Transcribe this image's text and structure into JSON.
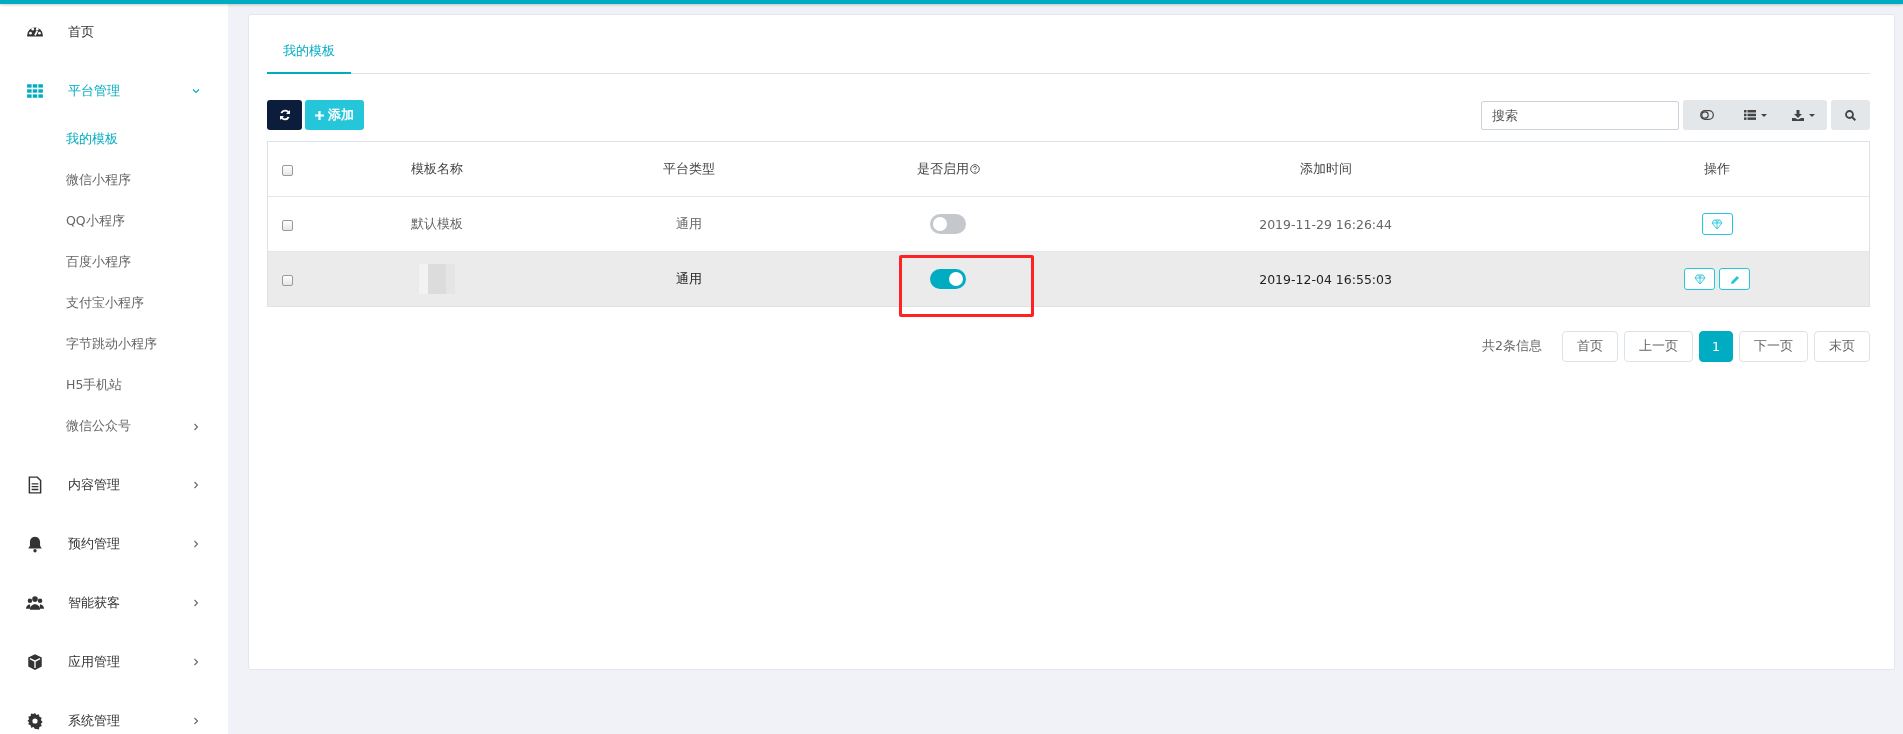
{
  "sidebar": {
    "items": [
      {
        "label": "首页",
        "selected": false,
        "has_arrow": false
      },
      {
        "label": "平台管理",
        "selected": true,
        "expanded": true,
        "has_arrow": true,
        "children": [
          {
            "label": "我的模板",
            "selected": true,
            "has_arrow": false
          },
          {
            "label": "微信小程序",
            "selected": false,
            "has_arrow": false
          },
          {
            "label": "QQ小程序",
            "selected": false,
            "has_arrow": false
          },
          {
            "label": "百度小程序",
            "selected": false,
            "has_arrow": false
          },
          {
            "label": "支付宝小程序",
            "selected": false,
            "has_arrow": false
          },
          {
            "label": "字节跳动小程序",
            "selected": false,
            "has_arrow": false
          },
          {
            "label": "H5手机站",
            "selected": false,
            "has_arrow": false
          },
          {
            "label": "微信公众号",
            "selected": false,
            "has_arrow": true
          }
        ]
      },
      {
        "label": "内容管理",
        "selected": false,
        "expanded": false,
        "has_arrow": true
      },
      {
        "label": "预约管理",
        "selected": false,
        "expanded": false,
        "has_arrow": true
      },
      {
        "label": "智能获客",
        "selected": false,
        "expanded": false,
        "has_arrow": true
      },
      {
        "label": "应用管理",
        "selected": false,
        "expanded": false,
        "has_arrow": true
      },
      {
        "label": "系统管理",
        "selected": false,
        "expanded": false,
        "has_arrow": true
      }
    ]
  },
  "tabs": [
    {
      "label": "我的模板",
      "selected": true
    }
  ],
  "toolbar": {
    "add_label": "添加",
    "search": {
      "placeholder": "搜索"
    }
  },
  "table": {
    "all_checked": false,
    "columns": [
      "模板名称",
      "平台类型",
      "是否启用",
      "添加时间",
      "操作"
    ],
    "rows": [
      {
        "checked": false,
        "selected": false,
        "highlighted": false,
        "name": {
          "kind": "text",
          "text": "默认模板"
        },
        "platform": "通用",
        "on": false,
        "time": "2019-11-29 16:26:44",
        "editable": false
      },
      {
        "checked": false,
        "selected": true,
        "highlighted": true,
        "name": {
          "kind": "redacted"
        },
        "platform": "通用",
        "on": true,
        "time": "2019-12-04 16:55:03",
        "editable": true
      }
    ]
  },
  "pagination": {
    "summary": "共2条信息",
    "pages": [
      {
        "label": "首页",
        "selected": false
      },
      {
        "label": "上一页",
        "selected": false
      },
      {
        "label": "1",
        "selected": true
      },
      {
        "label": "下一页",
        "selected": false
      },
      {
        "label": "末页",
        "selected": false
      }
    ]
  }
}
